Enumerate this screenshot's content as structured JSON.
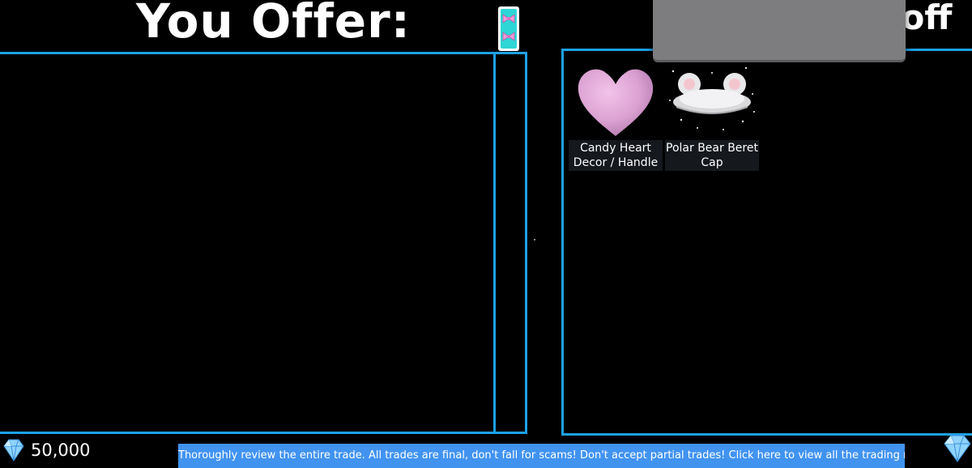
{
  "header": {
    "left_title": "You Offer:",
    "right_title_fragment": "'s off"
  },
  "colors": {
    "panel_border": "#1da1e6",
    "notice_bg": "#4193f0",
    "overlay_grey": "#7d7d80",
    "item_label_bg": "#15181d"
  },
  "your_offer": {
    "items": [],
    "scroll_thumb_icon": "bow-pattern-icon"
  },
  "their_offer": {
    "items": [
      {
        "name": "Candy Heart Decor / Handle",
        "icon": "pink-heart-icon"
      },
      {
        "name": "Polar Bear Beret Cap",
        "icon": "polar-bear-beret-icon"
      }
    ]
  },
  "footer": {
    "gems_amount": "50,000",
    "gem_icon": "diamond-icon",
    "notice_text": "Thoroughly review the entire trade. All trades are final, don't fall for scams! Don't accept partial trades! Click here to view all the trading rules"
  }
}
